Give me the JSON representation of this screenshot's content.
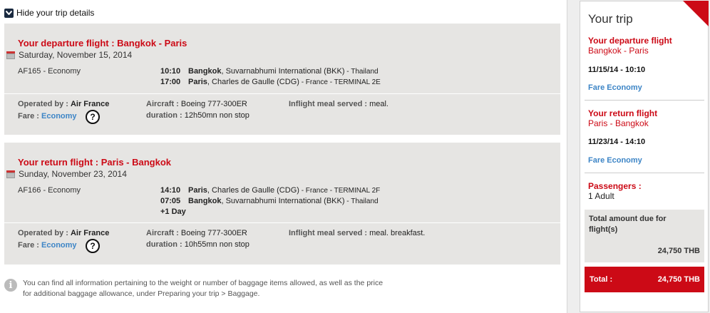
{
  "toggle_label": "Hide your trip details",
  "departure": {
    "title": "Your departure flight : Bangkok - Paris",
    "date": "Saturday, November 15, 2014",
    "code": "AF165 - Economy",
    "seg1": {
      "time": "10:10",
      "city": "Bangkok",
      "airport": ", Suvarnabhumi International (BKK)",
      "country": " - Thailand"
    },
    "seg2": {
      "time": "17:00",
      "city": "Paris",
      "airport": ", Charles de Gaulle (CDG)",
      "country": " - France - TERMINAL 2E"
    },
    "operated_label": "Operated by :",
    "operated_value": "Air France",
    "fare_label": "Fare :",
    "fare_value": "Economy",
    "aircraft_label": "Aircraft :",
    "aircraft_value": "Boeing 777-300ER",
    "duration_label": "duration :",
    "duration_value": "12h50mn non stop",
    "meal_label": "Inflight meal served :",
    "meal_value": "meal."
  },
  "return": {
    "title": "Your return flight : Paris - Bangkok",
    "date": "Sunday, November 23, 2014",
    "code": "AF166 - Economy",
    "seg1": {
      "time": "14:10",
      "city": "Paris",
      "airport": ", Charles de Gaulle (CDG)",
      "country": " - France - TERMINAL 2F"
    },
    "seg2": {
      "time": "07:05",
      "city": "Bangkok",
      "airport": ", Suvarnabhumi International (BKK)",
      "country": " - Thailand"
    },
    "plus_day": "+1 Day",
    "operated_label": "Operated by :",
    "operated_value": "Air France",
    "fare_label": "Fare :",
    "fare_value": "Economy",
    "aircraft_label": "Aircraft :",
    "aircraft_value": "Boeing 777-300ER",
    "duration_label": "duration :",
    "duration_value": "10h55mn non stop",
    "meal_label": "Inflight meal served :",
    "meal_value": "meal. breakfast."
  },
  "help_symbol": "?",
  "info_symbol": "i",
  "info_line1": "You can find all information pertaining to the weight or number of baggage items allowed, as well as the price",
  "info_line2": "for additional baggage allowance, under Preparing your trip > Baggage.",
  "panel": {
    "title": "Your trip",
    "dep_heading": "Your departure flight",
    "dep_route": "Bangkok - Paris",
    "dep_datetime": "11/15/14 - 10:10",
    "dep_fare": "Fare Economy",
    "ret_heading": "Your return flight",
    "ret_route": "Paris - Bangkok",
    "ret_datetime": "11/23/14 - 14:10",
    "ret_fare": "Fare Economy",
    "pax_heading": "Passengers :",
    "pax_value": "1 Adult",
    "total_due_label": "Total amount due for flight(s)",
    "total_due_amount": "24,750 THB",
    "total_label": "Total :",
    "total_amount": "24,750 THB"
  },
  "colors": {
    "brand_red": "#cc0a16",
    "link_blue": "#3d85c6",
    "panel_gray": "#e6e5e3"
  }
}
